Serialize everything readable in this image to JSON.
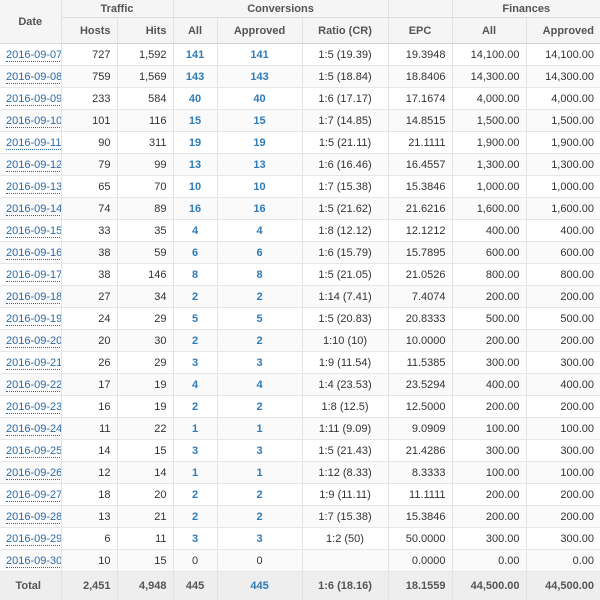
{
  "header": {
    "groups": {
      "traffic": "Traffic",
      "conversions": "Conversions",
      "finances": "Finances"
    },
    "columns": {
      "date": "Date",
      "hosts": "Hosts",
      "hits": "Hits",
      "all": "All",
      "approved": "Approved",
      "ratio": "Ratio (CR)",
      "epc": "EPC",
      "fin_all": "All",
      "fin_approved": "Approved"
    }
  },
  "rows": [
    {
      "date": "2016-09-07",
      "hosts": "727",
      "hits": "1,592",
      "all": "141",
      "approved": "141",
      "ratio": "1:5 (19.39)",
      "epc": "19.3948",
      "fin_all": "14,100.00",
      "fin_approved": "14,100.00"
    },
    {
      "date": "2016-09-08",
      "hosts": "759",
      "hits": "1,569",
      "all": "143",
      "approved": "143",
      "ratio": "1:5 (18.84)",
      "epc": "18.8406",
      "fin_all": "14,300.00",
      "fin_approved": "14,300.00"
    },
    {
      "date": "2016-09-09",
      "hosts": "233",
      "hits": "584",
      "all": "40",
      "approved": "40",
      "ratio": "1:6 (17.17)",
      "epc": "17.1674",
      "fin_all": "4,000.00",
      "fin_approved": "4,000.00"
    },
    {
      "date": "2016-09-10",
      "hosts": "101",
      "hits": "116",
      "all": "15",
      "approved": "15",
      "ratio": "1:7 (14.85)",
      "epc": "14.8515",
      "fin_all": "1,500.00",
      "fin_approved": "1,500.00"
    },
    {
      "date": "2016-09-11",
      "hosts": "90",
      "hits": "311",
      "all": "19",
      "approved": "19",
      "ratio": "1:5 (21.11)",
      "epc": "21.1111",
      "fin_all": "1,900.00",
      "fin_approved": "1,900.00"
    },
    {
      "date": "2016-09-12",
      "hosts": "79",
      "hits": "99",
      "all": "13",
      "approved": "13",
      "ratio": "1:6 (16.46)",
      "epc": "16.4557",
      "fin_all": "1,300.00",
      "fin_approved": "1,300.00"
    },
    {
      "date": "2016-09-13",
      "hosts": "65",
      "hits": "70",
      "all": "10",
      "approved": "10",
      "ratio": "1:7 (15.38)",
      "epc": "15.3846",
      "fin_all": "1,000.00",
      "fin_approved": "1,000.00"
    },
    {
      "date": "2016-09-14",
      "hosts": "74",
      "hits": "89",
      "all": "16",
      "approved": "16",
      "ratio": "1:5 (21.62)",
      "epc": "21.6216",
      "fin_all": "1,600.00",
      "fin_approved": "1,600.00"
    },
    {
      "date": "2016-09-15",
      "hosts": "33",
      "hits": "35",
      "all": "4",
      "approved": "4",
      "ratio": "1:8 (12.12)",
      "epc": "12.1212",
      "fin_all": "400.00",
      "fin_approved": "400.00"
    },
    {
      "date": "2016-09-16",
      "hosts": "38",
      "hits": "59",
      "all": "6",
      "approved": "6",
      "ratio": "1:6 (15.79)",
      "epc": "15.7895",
      "fin_all": "600.00",
      "fin_approved": "600.00"
    },
    {
      "date": "2016-09-17",
      "hosts": "38",
      "hits": "146",
      "all": "8",
      "approved": "8",
      "ratio": "1:5 (21.05)",
      "epc": "21.0526",
      "fin_all": "800.00",
      "fin_approved": "800.00"
    },
    {
      "date": "2016-09-18",
      "hosts": "27",
      "hits": "34",
      "all": "2",
      "approved": "2",
      "ratio": "1:14 (7.41)",
      "epc": "7.4074",
      "fin_all": "200.00",
      "fin_approved": "200.00"
    },
    {
      "date": "2016-09-19",
      "hosts": "24",
      "hits": "29",
      "all": "5",
      "approved": "5",
      "ratio": "1:5 (20.83)",
      "epc": "20.8333",
      "fin_all": "500.00",
      "fin_approved": "500.00"
    },
    {
      "date": "2016-09-20",
      "hosts": "20",
      "hits": "30",
      "all": "2",
      "approved": "2",
      "ratio": "1:10 (10)",
      "epc": "10.0000",
      "fin_all": "200.00",
      "fin_approved": "200.00"
    },
    {
      "date": "2016-09-21",
      "hosts": "26",
      "hits": "29",
      "all": "3",
      "approved": "3",
      "ratio": "1:9 (11.54)",
      "epc": "11.5385",
      "fin_all": "300.00",
      "fin_approved": "300.00"
    },
    {
      "date": "2016-09-22",
      "hosts": "17",
      "hits": "19",
      "all": "4",
      "approved": "4",
      "ratio": "1:4 (23.53)",
      "epc": "23.5294",
      "fin_all": "400.00",
      "fin_approved": "400.00"
    },
    {
      "date": "2016-09-23",
      "hosts": "16",
      "hits": "19",
      "all": "2",
      "approved": "2",
      "ratio": "1:8 (12.5)",
      "epc": "12.5000",
      "fin_all": "200.00",
      "fin_approved": "200.00"
    },
    {
      "date": "2016-09-24",
      "hosts": "11",
      "hits": "22",
      "all": "1",
      "approved": "1",
      "ratio": "1:11 (9.09)",
      "epc": "9.0909",
      "fin_all": "100.00",
      "fin_approved": "100.00"
    },
    {
      "date": "2016-09-25",
      "hosts": "14",
      "hits": "15",
      "all": "3",
      "approved": "3",
      "ratio": "1:5 (21.43)",
      "epc": "21.4286",
      "fin_all": "300.00",
      "fin_approved": "300.00"
    },
    {
      "date": "2016-09-26",
      "hosts": "12",
      "hits": "14",
      "all": "1",
      "approved": "1",
      "ratio": "1:12 (8.33)",
      "epc": "8.3333",
      "fin_all": "100.00",
      "fin_approved": "100.00"
    },
    {
      "date": "2016-09-27",
      "hosts": "18",
      "hits": "20",
      "all": "2",
      "approved": "2",
      "ratio": "1:9 (11.11)",
      "epc": "11.1111",
      "fin_all": "200.00",
      "fin_approved": "200.00"
    },
    {
      "date": "2016-09-28",
      "hosts": "13",
      "hits": "21",
      "all": "2",
      "approved": "2",
      "ratio": "1:7 (15.38)",
      "epc": "15.3846",
      "fin_all": "200.00",
      "fin_approved": "200.00"
    },
    {
      "date": "2016-09-29",
      "hosts": "6",
      "hits": "11",
      "all": "3",
      "approved": "3",
      "ratio": "1:2 (50)",
      "epc": "50.0000",
      "fin_all": "300.00",
      "fin_approved": "300.00"
    },
    {
      "date": "2016-09-30",
      "hosts": "10",
      "hits": "15",
      "all": "0",
      "approved": "0",
      "ratio": "",
      "epc": "0.0000",
      "fin_all": "0.00",
      "fin_approved": "0.00"
    }
  ],
  "totals": {
    "label": "Total",
    "hosts": "2,451",
    "hits": "4,948",
    "all": "445",
    "approved": "445",
    "ratio": "1:6 (18.16)",
    "epc": "18.1559",
    "fin_all": "44,500.00",
    "fin_approved": "44,500.00"
  }
}
